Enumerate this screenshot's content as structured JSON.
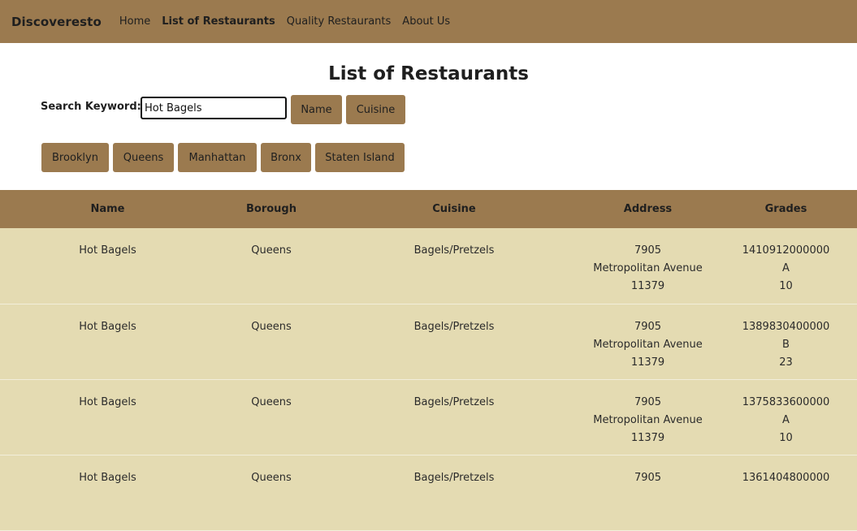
{
  "nav": {
    "brand": "Discoveresto",
    "links": [
      "Home",
      "List of Restaurants",
      "Quality Restaurants",
      "About Us"
    ]
  },
  "page": {
    "title": "List of Restaurants"
  },
  "search": {
    "label": "Search Keyword:",
    "value": "Hot Bagels",
    "buttons": [
      "Name",
      "Cuisine"
    ]
  },
  "boroughs": [
    "Brooklyn",
    "Queens",
    "Manhattan",
    "Bronx",
    "Staten Island"
  ],
  "table": {
    "headers": [
      "Name",
      "Borough",
      "Cuisine",
      "Address",
      "Grades"
    ],
    "rows": [
      {
        "name": "Hot Bagels",
        "borough": "Queens",
        "cuisine": "Bagels/Pretzels",
        "address": [
          "7905",
          "Metropolitan Avenue",
          "11379"
        ],
        "grades": [
          "1410912000000",
          "A",
          "10"
        ]
      },
      {
        "name": "Hot Bagels",
        "borough": "Queens",
        "cuisine": "Bagels/Pretzels",
        "address": [
          "7905",
          "Metropolitan Avenue",
          "11379"
        ],
        "grades": [
          "1389830400000",
          "B",
          "23"
        ]
      },
      {
        "name": "Hot Bagels",
        "borough": "Queens",
        "cuisine": "Bagels/Pretzels",
        "address": [
          "7905",
          "Metropolitan Avenue",
          "11379"
        ],
        "grades": [
          "1375833600000",
          "A",
          "10"
        ]
      },
      {
        "name": "Hot Bagels",
        "borough": "Queens",
        "cuisine": "Bagels/Pretzels",
        "address": [
          "7905"
        ],
        "grades": [
          "1361404800000"
        ]
      }
    ]
  },
  "colors": {
    "nav_bg": "#9b7a4f",
    "button_bg": "#9b7a4f",
    "row_bg": "#e4dbb2"
  }
}
